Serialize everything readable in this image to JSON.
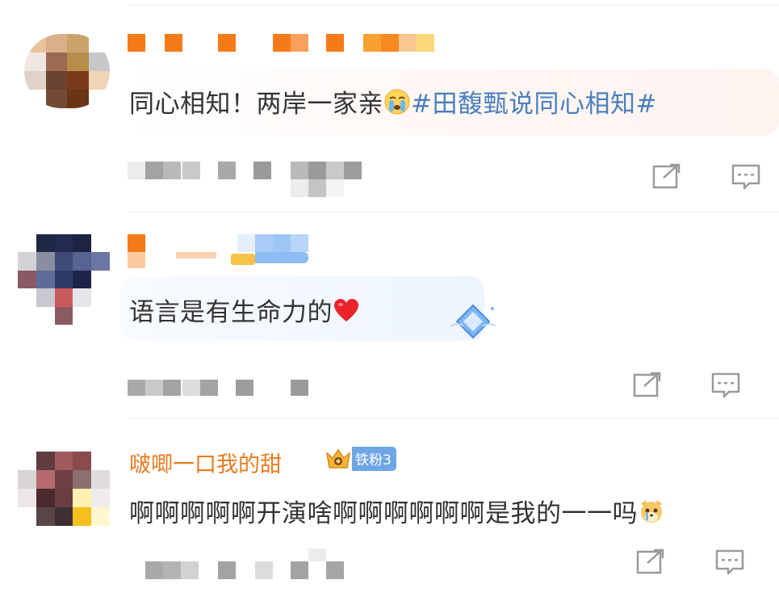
{
  "comments": [
    {
      "username": "",
      "badge": "",
      "text": "同心相知！两岸一家亲",
      "emoji": "crying-face-emoji",
      "topic": "#田馥甄说同心相知#",
      "actions": {
        "share_icon": "share-icon",
        "reply_icon": "comment-icon"
      }
    },
    {
      "username": "",
      "badge": "",
      "text": "语言是有生命力的",
      "emoji": "red-heart-emoji",
      "actions": {
        "share_icon": "share-icon",
        "reply_icon": "comment-icon"
      }
    },
    {
      "username": "啵唧一口我的甜",
      "badge": "铁粉3",
      "text": "啊啊啊啊啊开演啥啊啊啊啊啊啊是我的一一吗",
      "emoji": "dog-emoji",
      "actions": {
        "share_icon": "share-icon",
        "reply_icon": "comment-icon"
      }
    }
  ],
  "colors": {
    "username": "#e87c1e",
    "topic": "#4a7fbd",
    "text": "#333333",
    "badge_blue": "#6ea6e8",
    "icon_gray": "#9a9a9a"
  }
}
